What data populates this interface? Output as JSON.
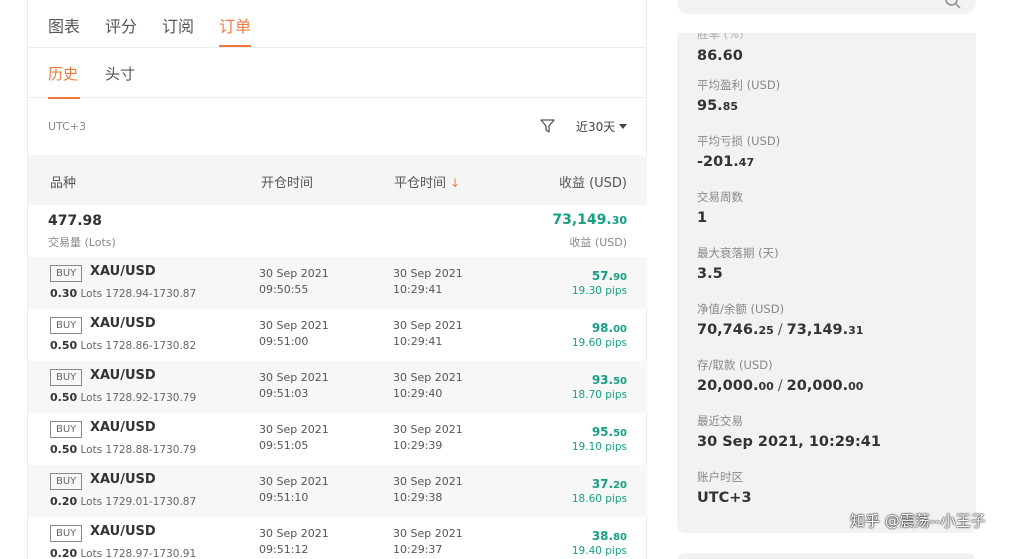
{
  "tabs": [
    "图表",
    "评分",
    "订阅",
    "订单"
  ],
  "subtabs": [
    "历史",
    "头寸"
  ],
  "filter": {
    "timezone": "UTC+3",
    "range": "近30天"
  },
  "table": {
    "headers": {
      "symbol": "品种",
      "open_time": "开仓时间",
      "close_time": "平仓时间",
      "profit": "收益 (USD)"
    },
    "summary": {
      "lots": "477.98",
      "lots_label": "交易量 (Lots)",
      "profit_main": "73,149.",
      "profit_small": "30",
      "profit_label": "收益 (USD)"
    },
    "rows": [
      {
        "side": "BUY",
        "symbol": "XAU/USD",
        "lots": "0.30",
        "lots_unit": "Lots",
        "range": "1728.94-1730.87",
        "open_date": "30 Sep 2021",
        "open_time": "09:50:55",
        "close_date": "30 Sep 2021",
        "close_time": "10:29:41",
        "profit_main": "57.",
        "profit_small": "90",
        "pips": "19.30 pips"
      },
      {
        "side": "BUY",
        "symbol": "XAU/USD",
        "lots": "0.50",
        "lots_unit": "Lots",
        "range": "1728.86-1730.82",
        "open_date": "30 Sep 2021",
        "open_time": "09:51:00",
        "close_date": "30 Sep 2021",
        "close_time": "10:29:41",
        "profit_main": "98.",
        "profit_small": "00",
        "pips": "19.60 pips"
      },
      {
        "side": "BUY",
        "symbol": "XAU/USD",
        "lots": "0.50",
        "lots_unit": "Lots",
        "range": "1728.92-1730.79",
        "open_date": "30 Sep 2021",
        "open_time": "09:51:03",
        "close_date": "30 Sep 2021",
        "close_time": "10:29:40",
        "profit_main": "93.",
        "profit_small": "50",
        "pips": "18.70 pips"
      },
      {
        "side": "BUY",
        "symbol": "XAU/USD",
        "lots": "0.50",
        "lots_unit": "Lots",
        "range": "1728.88-1730.79",
        "open_date": "30 Sep 2021",
        "open_time": "09:51:05",
        "close_date": "30 Sep 2021",
        "close_time": "10:29:39",
        "profit_main": "95.",
        "profit_small": "50",
        "pips": "19.10 pips"
      },
      {
        "side": "BUY",
        "symbol": "XAU/USD",
        "lots": "0.20",
        "lots_unit": "Lots",
        "range": "1729.01-1730.87",
        "open_date": "30 Sep 2021",
        "open_time": "09:51:10",
        "close_date": "30 Sep 2021",
        "close_time": "10:29:38",
        "profit_main": "37.",
        "profit_small": "20",
        "pips": "18.60 pips"
      },
      {
        "side": "BUY",
        "symbol": "XAU/USD",
        "lots": "0.20",
        "lots_unit": "Lots",
        "range": "1728.97-1730.91",
        "open_date": "30 Sep 2021",
        "open_time": "09:51:12",
        "close_date": "30 Sep 2021",
        "close_time": "10:29:37",
        "profit_main": "38.",
        "profit_small": "80",
        "pips": "19.40 pips"
      }
    ]
  },
  "stats": {
    "partial_label": "胜率 (%)",
    "items": [
      {
        "label": "",
        "value_main": "86.60",
        "value_small": ""
      },
      {
        "label": "平均盈利 (USD)",
        "value_main": "95.",
        "value_small": "85"
      },
      {
        "label": "平均亏损 (USD)",
        "value_main": "-201.",
        "value_small": "47"
      },
      {
        "label": "交易周数",
        "value_main": "1",
        "value_small": ""
      },
      {
        "label": "最大衰落期 (天)",
        "value_main": "3.5",
        "value_small": ""
      },
      {
        "label": "净值/余额 (USD)",
        "value_main": "70,746.",
        "value_small": "25",
        "value2_main": "73,149.",
        "value2_small": "31"
      },
      {
        "label": "存/取款 (USD)",
        "value_main": "20,000.",
        "value_small": "00",
        "value2_main": "20,000.",
        "value2_small": "00"
      },
      {
        "label": "最近交易",
        "value_main": "30 Sep 2021, 10:29:41",
        "value_small": ""
      },
      {
        "label": "账户时区",
        "value_main": "UTC+3",
        "value_small": ""
      }
    ]
  },
  "watermark": "知乎 @震荡--小王子",
  "colors": {
    "accent": "#f0793f",
    "profit": "#16a085"
  }
}
